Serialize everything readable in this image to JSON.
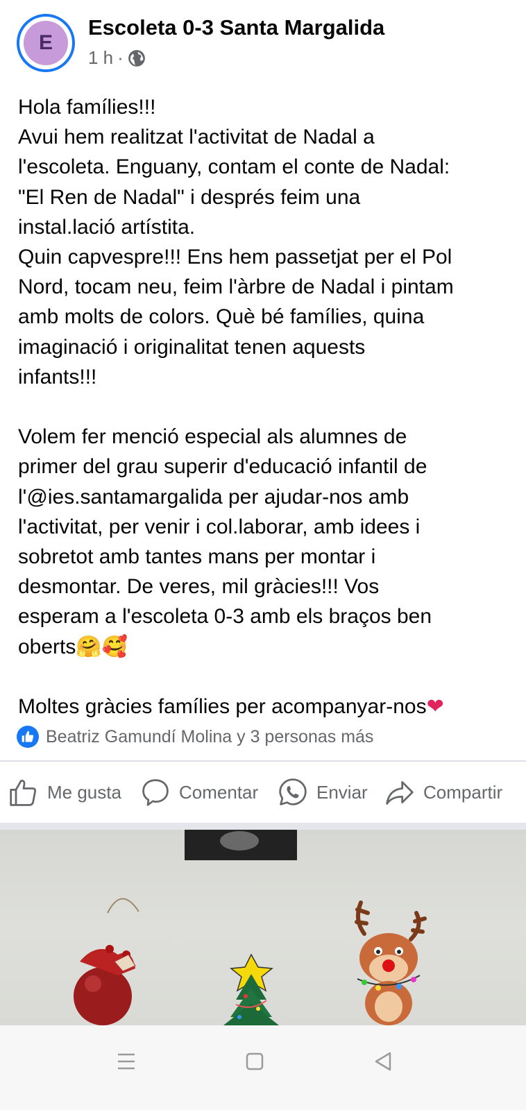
{
  "post": {
    "page_name": "Escoleta 0-3 Santa Margalida",
    "avatar_letter": "E",
    "time": "1 h",
    "separator": "·",
    "audience_icon": "globe-icon",
    "text_lines": [
      "Hola famílies!!!",
      "Avui hem realitzat l'activitat de Nadal a",
      "l'escoleta. Enguany, contam el conte de Nadal:",
      "\"El Ren de Nadal\" i després feim una",
      "instal.lació artístita.",
      "Quin capvespre!!! Ens hem passetjat per el Pol",
      "Nord, tocam neu, feim l'àrbre de Nadal i pintam",
      "amb molts de colors. Què bé famílies, quina",
      "imaginació i originalitat tenen aquests",
      "infants!!!",
      "",
      "Volem fer menció especial als alumnes de",
      "primer del grau superir d'educació infantil de",
      "l'@ies.santamargalida per ajudar-nos amb",
      "l'activitat, per venir i col.laborar, amb idees i",
      "sobretot amb tantes mans per montar i",
      "desmontar. De veres, mil gràcies!!! Vos",
      "esperam a l'escoleta 0-3 amb els braços ben",
      "oberts",
      "",
      "Moltes gràcies famílies per acompanyar-nos"
    ],
    "emoji_after_oberts": "🤗🥰",
    "emoji_after_last": "❤"
  },
  "reactions": {
    "icon": "like-icon",
    "text": "Beatriz Gamundí Molina y 3 personas más"
  },
  "actions": {
    "like": "Me gusta",
    "comment": "Comentar",
    "send": "Enviar",
    "share": "Compartir"
  },
  "photo": {
    "icons": [
      "bell-ornament-icon",
      "christmas-tree-icon",
      "reindeer-icon"
    ]
  },
  "navbar": {
    "icons": [
      "menu-icon",
      "home-square-icon",
      "back-triangle-icon"
    ]
  },
  "colors": {
    "accent": "#1877f2",
    "text": "#050505",
    "secondary_text": "#65676b",
    "avatar_bg": "#c79ad9"
  }
}
